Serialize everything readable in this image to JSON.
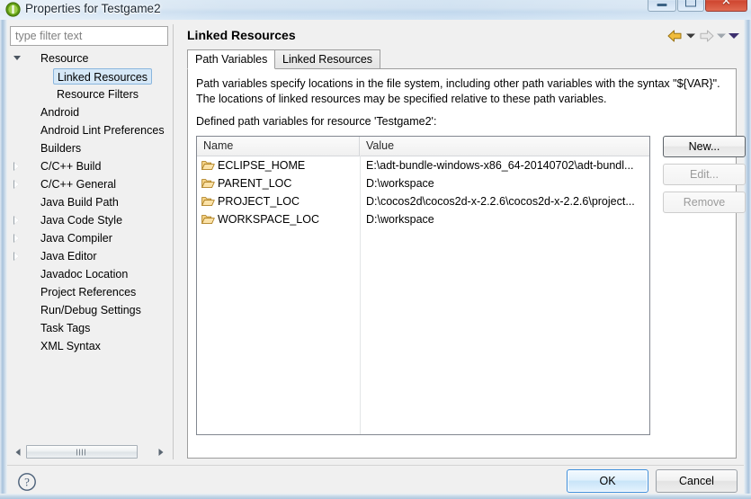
{
  "window": {
    "title": "Properties for Testgame2",
    "icon": "eclipse-icon",
    "minimize_label": "Minimize",
    "maximize_label": "Maximize",
    "close_label": "✕"
  },
  "filter": {
    "placeholder": "type filter text",
    "value": ""
  },
  "tree": {
    "items": [
      {
        "label": "Resource",
        "indent": 0,
        "twisty": "expanded",
        "selected": false
      },
      {
        "label": "Linked Resources",
        "indent": 1,
        "twisty": "none",
        "selected": true
      },
      {
        "label": "Resource Filters",
        "indent": 1,
        "twisty": "none",
        "selected": false
      },
      {
        "label": "Android",
        "indent": 0,
        "twisty": "none",
        "selected": false
      },
      {
        "label": "Android Lint Preferences",
        "indent": 0,
        "twisty": "none",
        "selected": false
      },
      {
        "label": "Builders",
        "indent": 0,
        "twisty": "none",
        "selected": false
      },
      {
        "label": "C/C++ Build",
        "indent": 0,
        "twisty": "collapsed",
        "selected": false
      },
      {
        "label": "C/C++ General",
        "indent": 0,
        "twisty": "collapsed",
        "selected": false
      },
      {
        "label": "Java Build Path",
        "indent": 0,
        "twisty": "none",
        "selected": false
      },
      {
        "label": "Java Code Style",
        "indent": 0,
        "twisty": "collapsed",
        "selected": false
      },
      {
        "label": "Java Compiler",
        "indent": 0,
        "twisty": "collapsed",
        "selected": false
      },
      {
        "label": "Java Editor",
        "indent": 0,
        "twisty": "collapsed",
        "selected": false
      },
      {
        "label": "Javadoc Location",
        "indent": 0,
        "twisty": "none",
        "selected": false
      },
      {
        "label": "Project References",
        "indent": 0,
        "twisty": "none",
        "selected": false
      },
      {
        "label": "Run/Debug Settings",
        "indent": 0,
        "twisty": "none",
        "selected": false
      },
      {
        "label": "Task Tags",
        "indent": 0,
        "twisty": "none",
        "selected": false
      },
      {
        "label": "XML Syntax",
        "indent": 0,
        "twisty": "none",
        "selected": false
      }
    ]
  },
  "page": {
    "title": "Linked Resources",
    "nav": {
      "back_icon": "back-arrow-icon",
      "back_menu_icon": "chevron-down-icon",
      "forward_icon": "forward-arrow-icon",
      "forward_menu_icon": "chevron-down-icon",
      "view_menu_icon": "chevron-down-icon"
    },
    "tabs": [
      {
        "label": "Path Variables",
        "active": true
      },
      {
        "label": "Linked Resources",
        "active": false
      }
    ],
    "description_line1": "Path variables specify locations in the file system, including other path variables with the syntax \"${VAR}\".",
    "description_line2": "The locations of linked resources may be specified relative to these path variables.",
    "defined_label": "Defined path variables for resource 'Testgame2':",
    "table": {
      "columns": [
        "Name",
        "Value"
      ],
      "rows": [
        {
          "icon": "folder-icon",
          "name": "ECLIPSE_HOME",
          "value": "E:\\adt-bundle-windows-x86_64-20140702\\adt-bundl..."
        },
        {
          "icon": "folder-icon",
          "name": "PARENT_LOC",
          "value": "D:\\workspace"
        },
        {
          "icon": "folder-icon",
          "name": "PROJECT_LOC",
          "value": "D:\\cocos2d\\cocos2d-x-2.2.6\\cocos2d-x-2.2.6\\project..."
        },
        {
          "icon": "folder-icon",
          "name": "WORKSPACE_LOC",
          "value": "D:\\workspace"
        }
      ]
    },
    "side_buttons": [
      {
        "label": "New...",
        "enabled": true
      },
      {
        "label": "Edit...",
        "enabled": false
      },
      {
        "label": "Remove",
        "enabled": false
      }
    ]
  },
  "footer": {
    "help_icon": "help-icon",
    "ok_label": "OK",
    "cancel_label": "Cancel"
  },
  "colors": {
    "selection_fill": "#d6e8f7",
    "selection_border": "#8ab6de",
    "folder_icon": "#e8b44a",
    "back_arrow": "#f0bc3c",
    "forward_arrow_disabled": "#d9d9d9",
    "menu_arrow": "#3c2f6e",
    "default_button_border": "#3c8ddb",
    "title_text": "#1b2733"
  }
}
